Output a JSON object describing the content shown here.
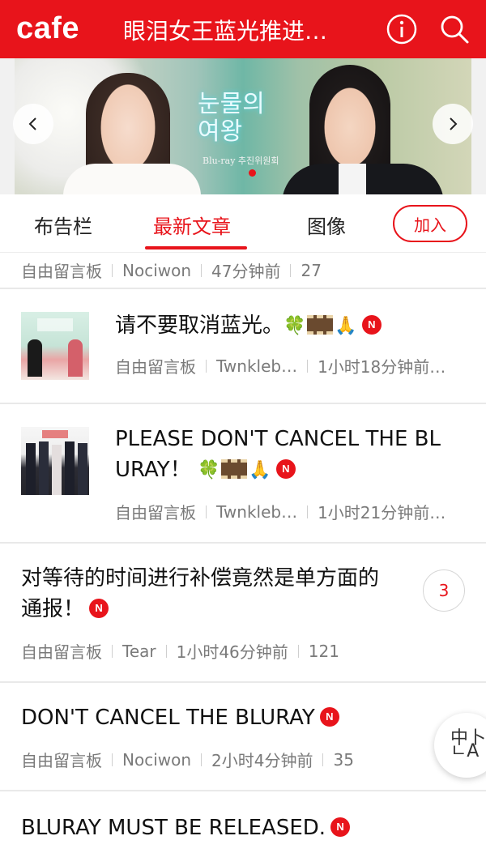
{
  "header": {
    "logo": "cafe",
    "title": "眼泪女王蓝光推进…",
    "info_icon": "info-circle-icon",
    "search_icon": "search-icon",
    "bg_color": "#e8141b"
  },
  "banner": {
    "logo_text_line1": "눈물의",
    "logo_text_line2": "여왕",
    "subtitle": "Blu-ray 추진위원회",
    "prev_icon": "chevron-left-icon",
    "next_icon": "chevron-right-icon"
  },
  "tabs": {
    "items": [
      "布告栏",
      "最新文章",
      "图像"
    ],
    "active": "最新文章",
    "join_label": "加入"
  },
  "posts": [
    {
      "title": "",
      "board": "自由留言板",
      "author": "Nociwon",
      "time": "47分钟前",
      "views": "27"
    },
    {
      "title": "请不要取消蓝光。",
      "emojis": [
        "🍀",
        "film",
        "🙏"
      ],
      "new_badge": "N",
      "board": "自由留言板",
      "author": "Twnkleb…",
      "time": "1小时18分钟前…"
    },
    {
      "title_line1": "PLEASE DON'T CANCEL THE BL",
      "title_line2": "URAY！",
      "emojis": [
        "🍀",
        "film",
        "🙏"
      ],
      "new_badge": "N",
      "board": "自由留言板",
      "author": "Twnkleb…",
      "time": "1小时21分钟前…"
    },
    {
      "title_line1": "对等待的时间进行补偿竟然是单方面的",
      "title_line2": "通报！",
      "new_badge": "N",
      "board": "自由留言板",
      "author": "Tear",
      "time": "1小时46分钟前",
      "views": "121",
      "comments": "3"
    },
    {
      "title": "DON'T CANCEL THE BLURAY",
      "new_badge": "N",
      "board": "自由留言板",
      "author": "Nociwon",
      "time": "2小时4分钟前",
      "views": "35"
    },
    {
      "title": "BLURAY MUST BE RELEASED.",
      "new_badge": "N"
    }
  ],
  "translate_fab": {
    "label_top": "中卜",
    "label_bottom": "ㄴA"
  }
}
